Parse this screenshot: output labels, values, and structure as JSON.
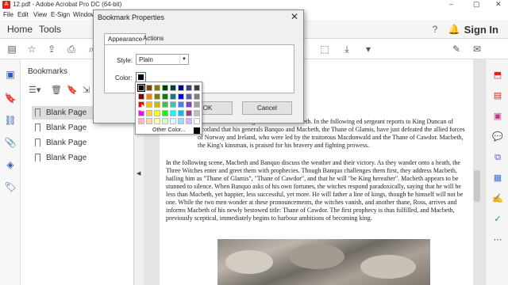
{
  "window": {
    "title": "12.pdf - Adobe Acrobat Pro DC (64-bit)"
  },
  "menu": {
    "items": [
      "File",
      "Edit",
      "View",
      "E-Sign",
      "Window"
    ]
  },
  "tabs": {
    "home": "Home",
    "tools": "Tools",
    "signin": "Sign In"
  },
  "bookmarks": {
    "header": "Bookmarks",
    "items": [
      "Blank Page",
      "Blank Page",
      "Blank Page",
      "Blank Page"
    ]
  },
  "dialog": {
    "title": "Bookmark Properties",
    "tab_appearance": "Appearance",
    "tab_actions": "Actions",
    "style_label": "Style:",
    "style_value": "Plain",
    "color_label": "Color:",
    "ok": "OK",
    "cancel": "Cancel"
  },
  "palette": {
    "other_label": "Other Color...",
    "colors": [
      [
        "#000000",
        "#7f3f00",
        "#7f7f00",
        "#003f00",
        "#003f3f",
        "#00007f",
        "#3f3f7f",
        "#3f3f3f"
      ],
      [
        "#7f0000",
        "#ff7f00",
        "#7f7f00",
        "#007f00",
        "#007f7f",
        "#0000ff",
        "#5f5f9f",
        "#7f7f7f"
      ],
      [
        "#ff0000",
        "#ffbf00",
        "#bfbf00",
        "#3fbf3f",
        "#3fbfbf",
        "#3f7fff",
        "#7f3fbf",
        "#9f9f9f"
      ],
      [
        "#ff00ff",
        "#ffcf3f",
        "#ffff00",
        "#00ff00",
        "#00ffff",
        "#00bfff",
        "#9f3f7f",
        "#bfbfbf"
      ],
      [
        "#ffafc0",
        "#ffd7a0",
        "#ffffa0",
        "#cfffcf",
        "#cfffff",
        "#a0d7ff",
        "#d7afff",
        "#ffffff"
      ]
    ]
  },
  "document": {
    "para1": "that their next meeting will be with Macbeth. In the following ed sergeant reports to King Duncan of Scotland that his generals Banquo and Macbeth, the Thane of Glamis, have just defeated the allied forces of Norway and Ireland, who were led by the traitorous Macdonwald and the Thane of Cawdor. Macbeth, the King's kinsman, is praised for his bravery and fighting prowess.",
    "para2": "In the following scene, Macbeth and Banquo discuss the weather and their victory. As they wander onto a heath, the Three Witches enter and greet them with prophecies. Though Banquo challenges them first, they address Macbeth, hailing him as \"Thane of Glamis\", \"Thane of Cawdor\", and that he will \"be King hereafter\". Macbeth appears to be stunned to silence. When Banquo asks of his own fortunes, the witches respond paradoxically, saying that he will be less than Macbeth, yet happier, less successful, yet more. He will father a line of kings, though he himself will not be one. While the two men wonder at these pronouncements, the witches vanish, and another thane, Ross, arrives and informs Macbeth of his newly bestowed title: Thane of Cawdor. The first prophecy is thus fulfilled, and Macbeth, previously sceptical, immediately begins to harbour ambitions of becoming king."
  }
}
